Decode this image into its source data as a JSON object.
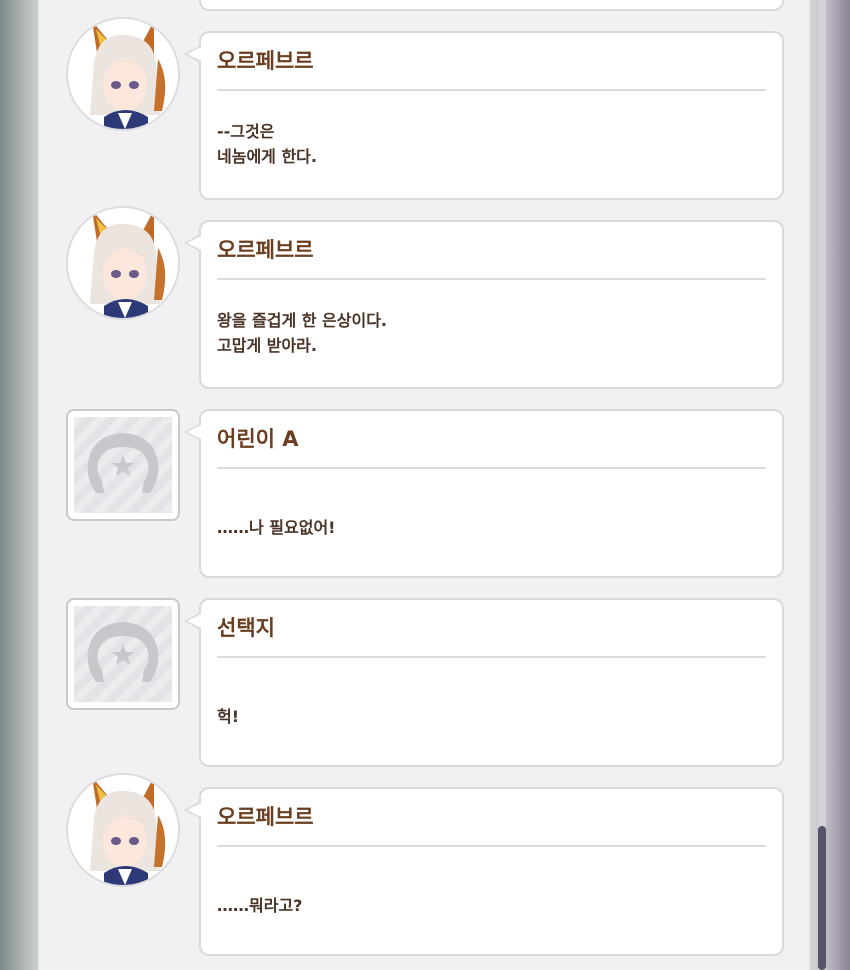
{
  "messages": [
    {
      "speaker": "오르페브르",
      "text": "‐-그것은\n네놈에게 한다.",
      "avatar": "character-portrait"
    },
    {
      "speaker": "오르페브르",
      "text": "왕을 즐겁게 한 은상이다.\n고맙게 받아라.",
      "avatar": "character-portrait"
    },
    {
      "speaker": "어린이 A",
      "text": "‥‥‥나 필요없어!",
      "avatar": "horseshoe-placeholder"
    },
    {
      "speaker": "선택지",
      "text": "헉!",
      "avatar": "horseshoe-placeholder"
    },
    {
      "speaker": "오르페브르",
      "text": "‥‥‥뭐라고?",
      "avatar": "character-portrait"
    }
  ],
  "colors": {
    "speaker": "#6b3e1f",
    "text": "#4a3326",
    "bubble_border": "#d9d9dd",
    "panel": "#f1f1f3",
    "scrollbar_thumb": "#55546a"
  },
  "icons": {
    "portrait": "horse-girl-portrait-icon",
    "placeholder": "horseshoe-star-icon"
  }
}
